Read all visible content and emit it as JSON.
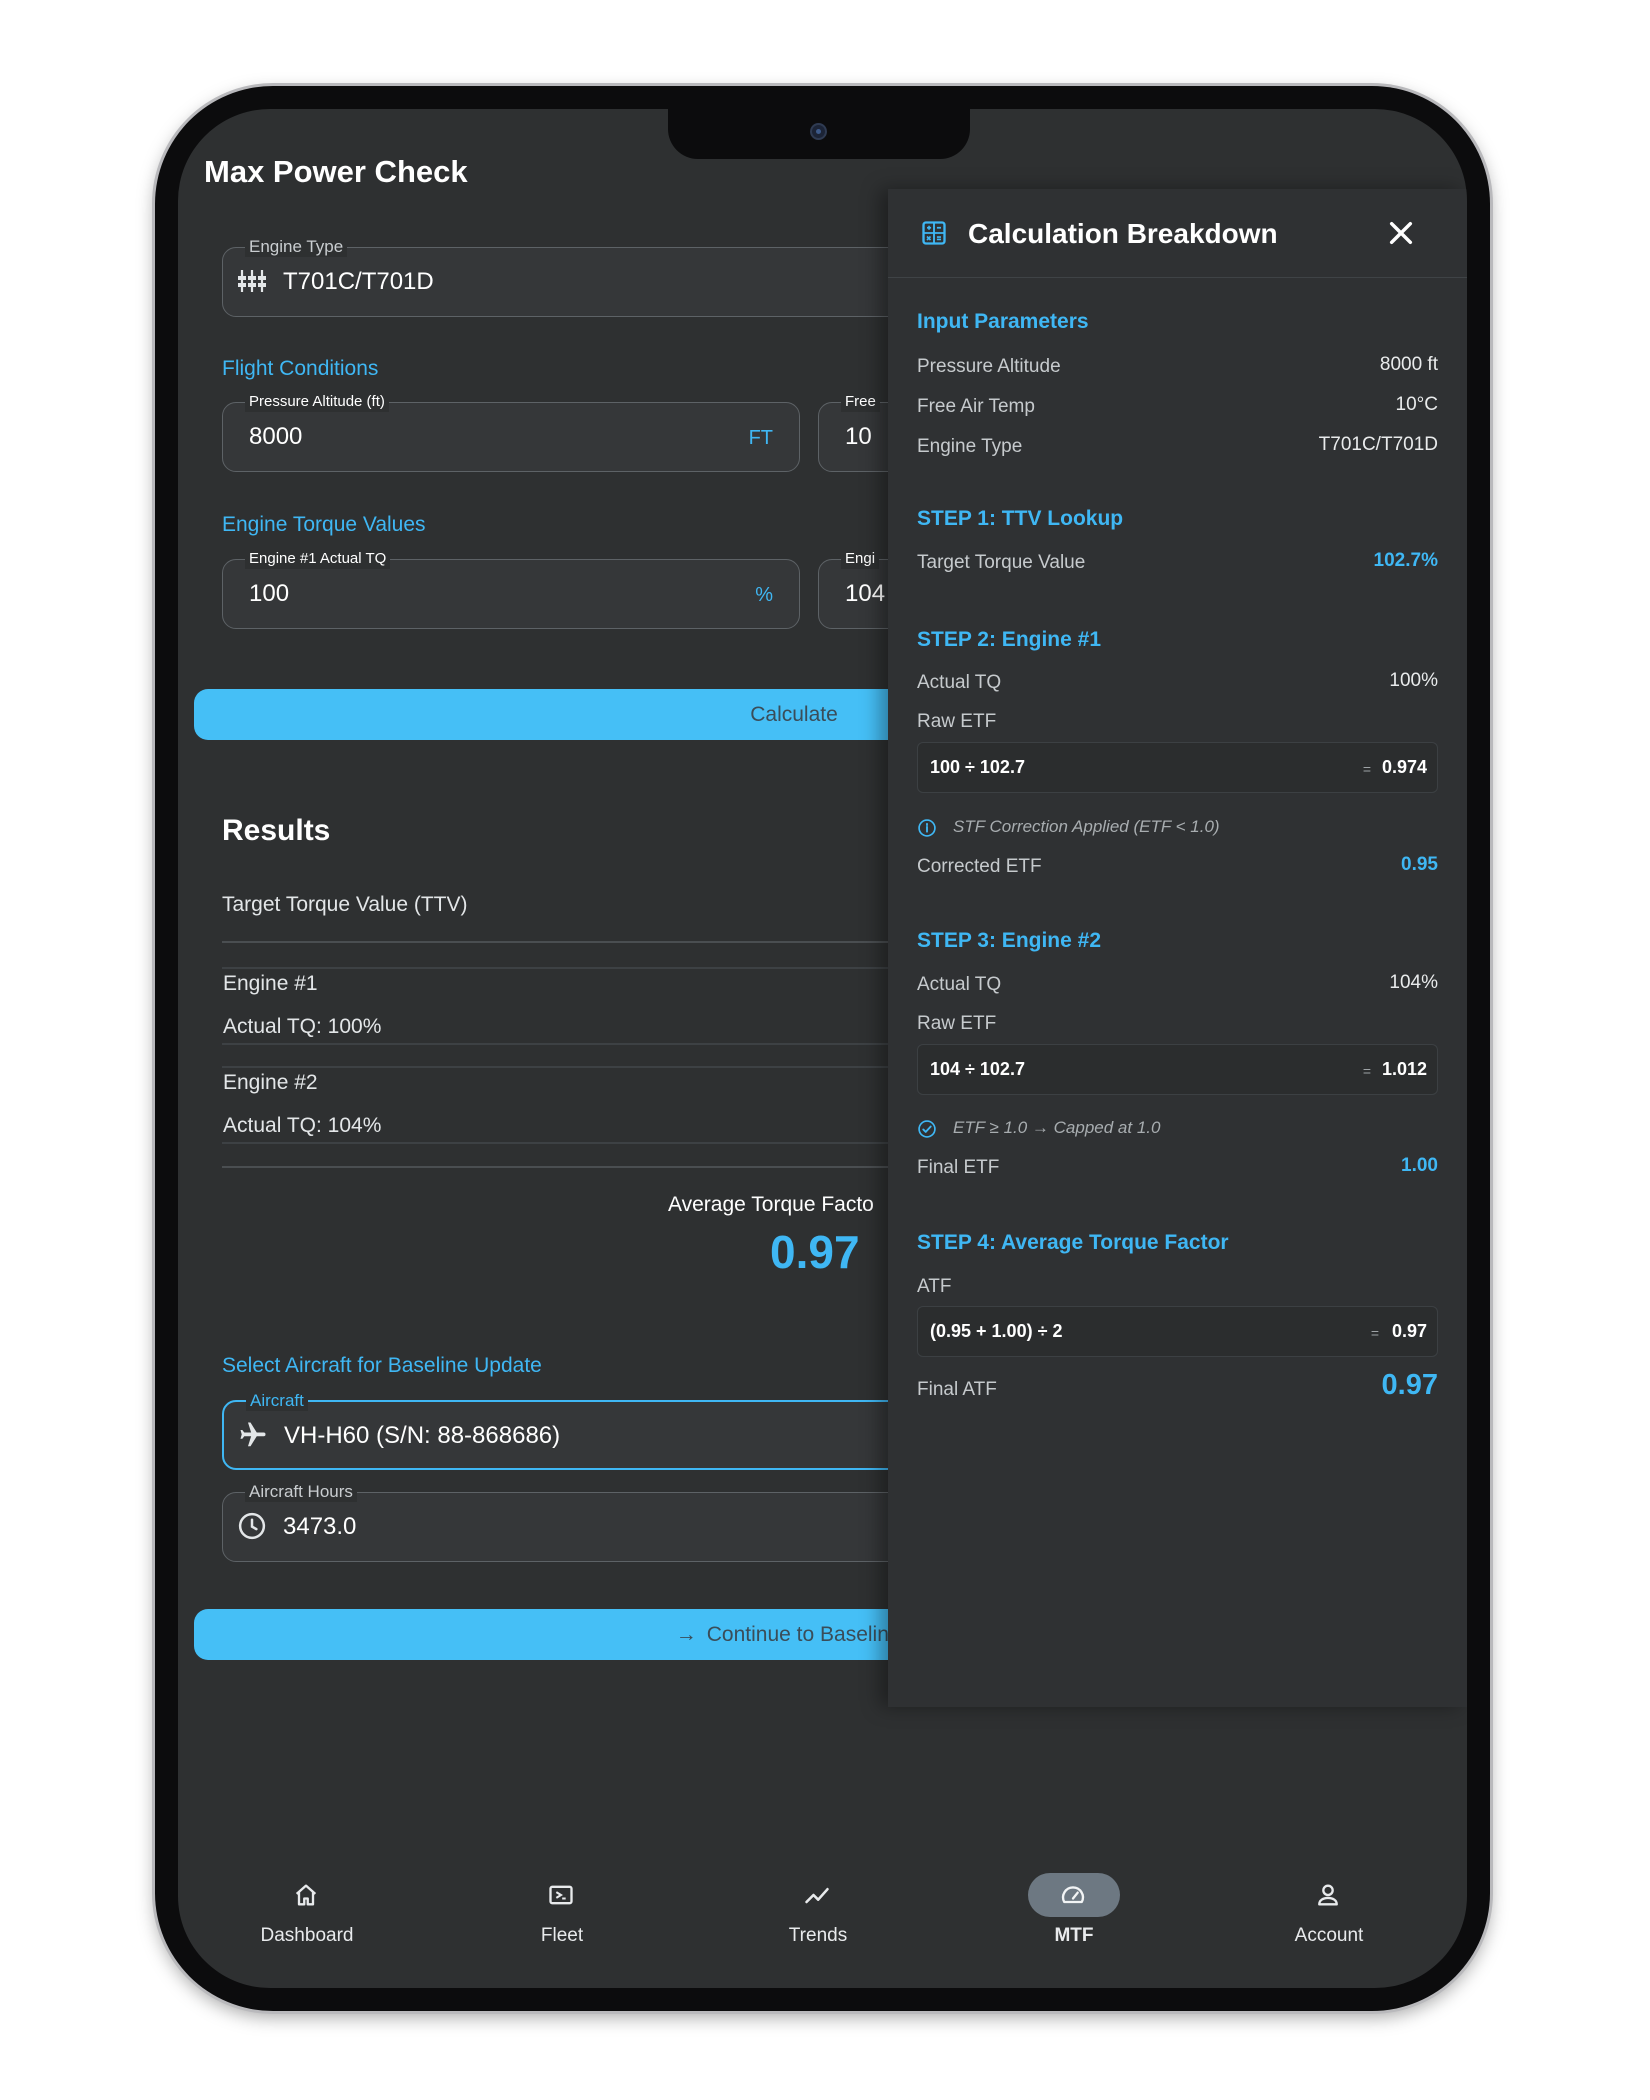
{
  "app": {
    "title": "Max Power Check"
  },
  "form": {
    "engine_type": {
      "label": "Engine Type",
      "value": "T701C/T701D"
    },
    "flight_conditions": {
      "title": "Flight Conditions",
      "pressure_altitude": {
        "label": "Pressure Altitude (ft)",
        "value": "8000",
        "unit": "FT"
      },
      "free_air_temp": {
        "label": "Free",
        "value": "10"
      }
    },
    "torque": {
      "title": "Engine Torque Values",
      "engine1": {
        "label": "Engine #1 Actual TQ",
        "value": "100",
        "unit": "%"
      },
      "engine2": {
        "label": "Engi",
        "value": "104"
      }
    },
    "calculate_label": "Calculate"
  },
  "results": {
    "title": "Results",
    "ttv_label": "Target Torque Value (TTV)",
    "engine1": {
      "name": "Engine #1",
      "actual": "Actual TQ: 100%"
    },
    "engine2": {
      "name": "Engine #2",
      "actual": "Actual TQ: 104%"
    },
    "atf_label": "Average Torque Facto",
    "atf_value": "0.97"
  },
  "baseline": {
    "title": "Select Aircraft for Baseline Update",
    "aircraft": {
      "label": "Aircraft",
      "value": "VH-H60 (S/N: 88-868686)"
    },
    "hours": {
      "label": "Aircraft Hours",
      "value": "3473.0"
    },
    "continue_label": "Continue to Baseline I"
  },
  "nav": {
    "items": [
      {
        "label": "Dashboard",
        "icon": "home-icon"
      },
      {
        "label": "Fleet",
        "icon": "fleet-icon"
      },
      {
        "label": "Trends",
        "icon": "trends-icon"
      },
      {
        "label": "MTF",
        "icon": "gauge-icon",
        "active": true
      },
      {
        "label": "Account",
        "icon": "account-icon"
      }
    ]
  },
  "panel": {
    "title": "Calculation Breakdown",
    "input": {
      "title": "Input Parameters",
      "rows": [
        {
          "label": "Pressure Altitude",
          "value": "8000 ft"
        },
        {
          "label": "Free Air Temp",
          "value": "10°C"
        },
        {
          "label": "Engine Type",
          "value": "T701C/T701D"
        }
      ]
    },
    "step1": {
      "title": "STEP 1: TTV Lookup",
      "label": "Target Torque Value",
      "value": "102.7%"
    },
    "step2": {
      "title": "STEP 2: Engine #1",
      "actual_label": "Actual TQ",
      "actual_value": "100%",
      "raw_label": "Raw ETF",
      "formula": "100 ÷ 102.7",
      "eq": "=",
      "result": "0.974",
      "note": "STF Correction Applied (ETF < 1.0)",
      "final_label": "Corrected ETF",
      "final_value": "0.95"
    },
    "step3": {
      "title": "STEP 3: Engine #2",
      "actual_label": "Actual TQ",
      "actual_value": "104%",
      "raw_label": "Raw ETF",
      "formula": "104 ÷ 102.7",
      "eq": "=",
      "result": "1.012",
      "note": "ETF ≥ 1.0 → Capped at 1.0",
      "final_label": "Final ETF",
      "final_value": "1.00"
    },
    "step4": {
      "title": "STEP 4: Average Torque Factor",
      "atf_label": "ATF",
      "formula": "(0.95 + 1.00) ÷ 2",
      "eq": "=",
      "result": "0.97",
      "final_label": "Final ATF",
      "final_value": "0.97"
    }
  },
  "colors": {
    "accent": "#3fb7f4",
    "background": "#2e3031",
    "panel": "#2f3133",
    "button": "#45bff6"
  }
}
